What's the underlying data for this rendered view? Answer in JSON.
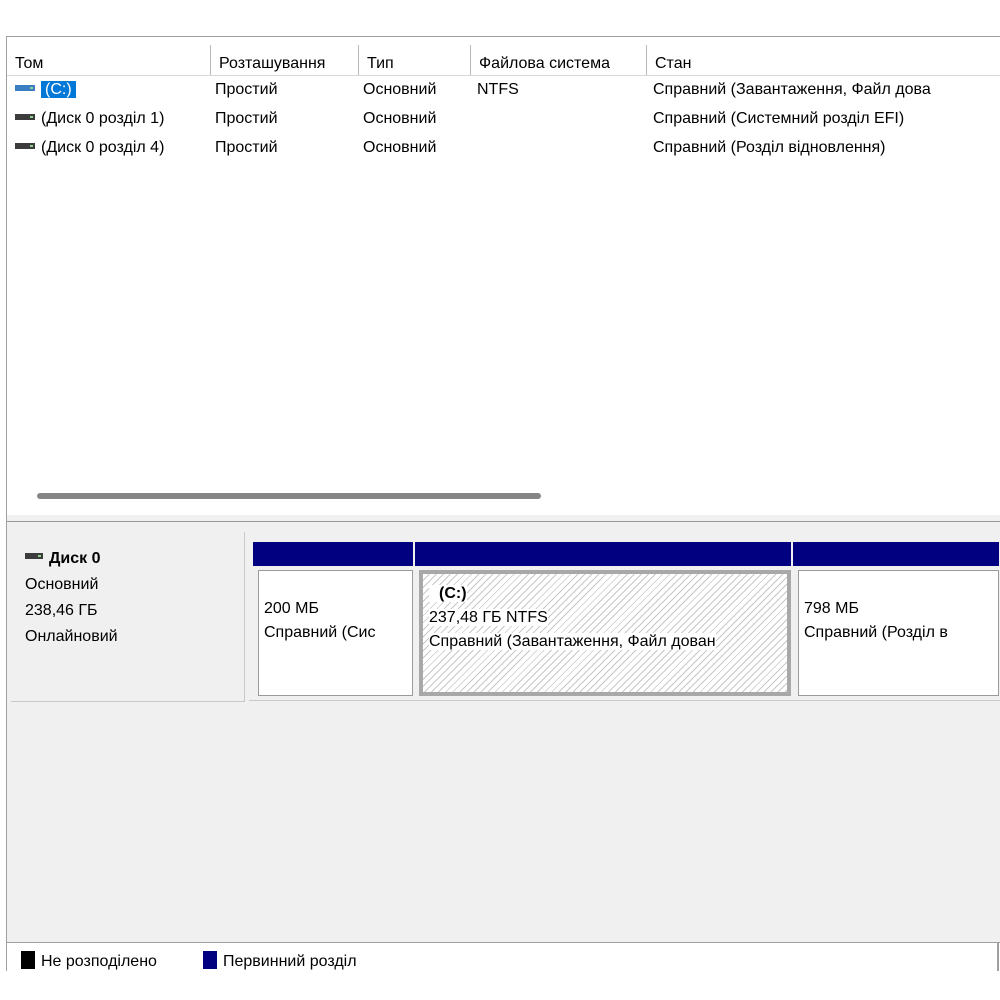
{
  "columns": [
    "Том",
    "Розташування",
    "Тип",
    "Файлова система",
    "Стан"
  ],
  "volumes": [
    {
      "name": "(C:)",
      "layout": "Простий",
      "type": "Основний",
      "fs": "NTFS",
      "status": "Справний (Завантаження, Файл дова",
      "icon": "drive-icon-blue",
      "selected": true
    },
    {
      "name": "(Диск 0 розділ 1)",
      "layout": "Простий",
      "type": "Основний",
      "fs": "",
      "status": "Справний (Системний розділ EFI)",
      "icon": "drive-icon-dark",
      "selected": false
    },
    {
      "name": "(Диск 0 розділ 4)",
      "layout": "Простий",
      "type": "Основний",
      "fs": "",
      "status": "Справний (Розділ відновлення)",
      "icon": "drive-icon-dark",
      "selected": false
    }
  ],
  "disk": {
    "name": "Диск 0",
    "type": "Основний",
    "size": "238,46 ГБ",
    "state": "Онлайновий"
  },
  "partitions": [
    {
      "label": "",
      "size": "200 МБ",
      "status": "Справний (Сис",
      "selected": false
    },
    {
      "label": "(C:)",
      "size": "237,48 ГБ NTFS",
      "status": "Справний (Завантаження, Файл дован",
      "selected": true
    },
    {
      "label": "",
      "size": "798 МБ",
      "status": "Справний (Розділ в",
      "selected": false
    }
  ],
  "legend": [
    {
      "label": "Не розподілено",
      "color": "#000000"
    },
    {
      "label": "Первинний розділ",
      "color": "#000080"
    }
  ],
  "colors": {
    "selection": "#0078d7",
    "partition_bar": "#000080",
    "drive_blue": "#3a7fc4",
    "drive_dark": "#3c3c3c"
  }
}
